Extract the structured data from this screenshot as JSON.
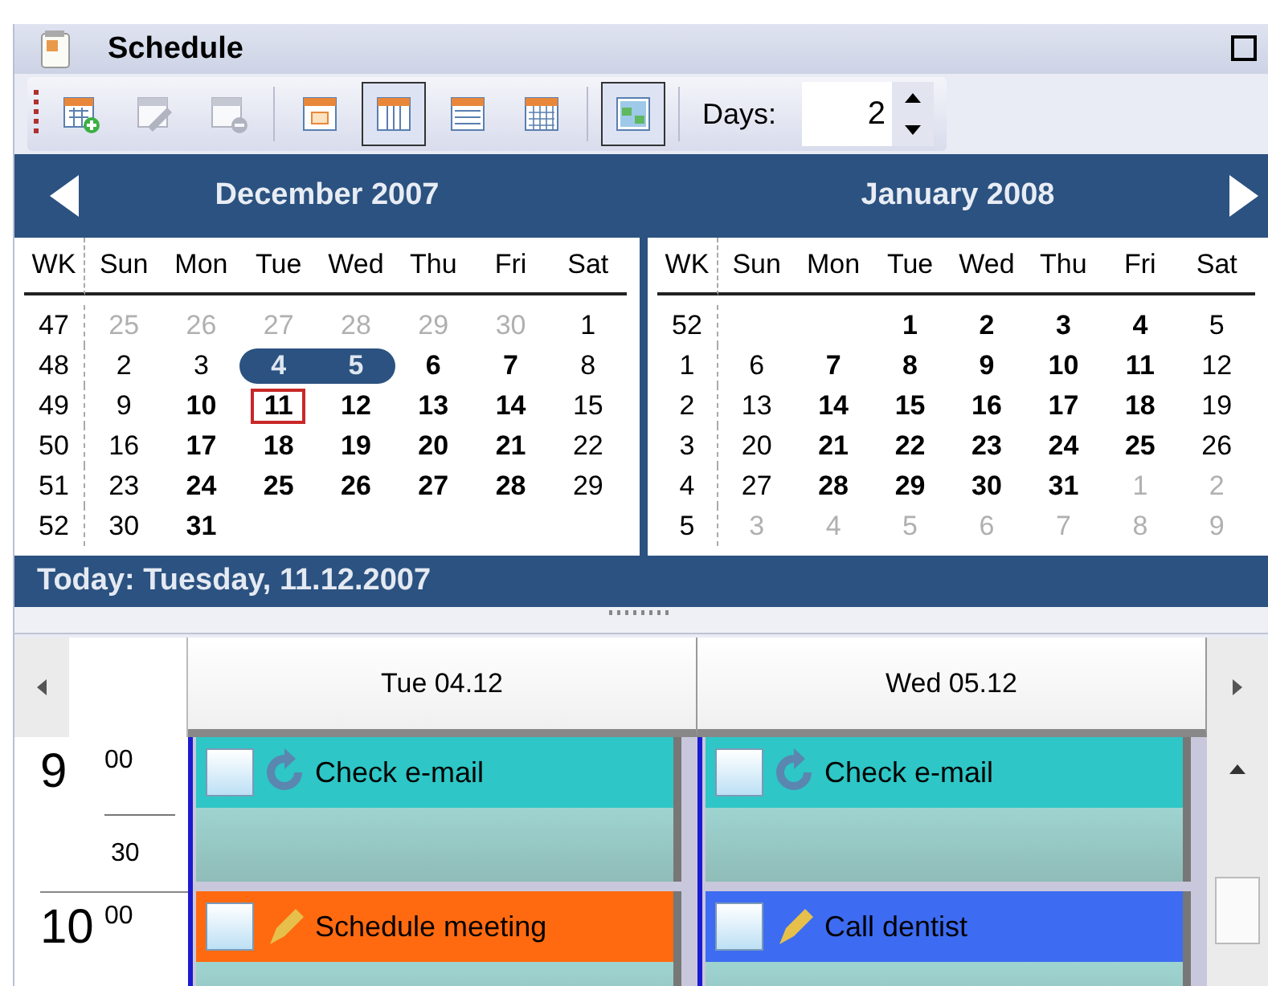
{
  "window": {
    "title": "Schedule"
  },
  "toolbar": {
    "buttons": [
      {
        "kind": "add",
        "disabled": false,
        "selected": false
      },
      {
        "kind": "edit",
        "disabled": true,
        "selected": false
      },
      {
        "kind": "delete",
        "disabled": true,
        "selected": false
      },
      {
        "kind": "day",
        "disabled": false,
        "selected": false
      },
      {
        "kind": "week",
        "disabled": false,
        "selected": true
      },
      {
        "kind": "list",
        "disabled": false,
        "selected": false
      },
      {
        "kind": "month",
        "disabled": false,
        "selected": false
      },
      {
        "kind": "grid",
        "disabled": false,
        "selected": true
      }
    ],
    "days_label": "Days:",
    "days_value": "2"
  },
  "months": [
    {
      "title": "December 2007",
      "weekdays": [
        "WK",
        "Sun",
        "Mon",
        "Tue",
        "Wed",
        "Thu",
        "Fri",
        "Sat"
      ],
      "weeks": [
        {
          "wk": "47",
          "days": [
            {
              "text": "25",
              "kind": "muted",
              "selected": false,
              "today": false
            },
            {
              "text": "26",
              "kind": "muted",
              "selected": false,
              "today": false
            },
            {
              "text": "27",
              "kind": "muted",
              "selected": false,
              "today": false
            },
            {
              "text": "28",
              "kind": "muted",
              "selected": false,
              "today": false
            },
            {
              "text": "29",
              "kind": "muted",
              "selected": false,
              "today": false
            },
            {
              "text": "30",
              "kind": "muted",
              "selected": false,
              "today": false
            },
            {
              "text": "1",
              "kind": "plain",
              "selected": false,
              "today": false
            }
          ]
        },
        {
          "wk": "48",
          "days": [
            {
              "text": "2",
              "kind": "plain",
              "selected": false,
              "today": false
            },
            {
              "text": "3",
              "kind": "plain",
              "selected": false,
              "today": false
            },
            {
              "text": "4",
              "kind": "bold",
              "selected": true,
              "today": false
            },
            {
              "text": "5",
              "kind": "bold",
              "selected": true,
              "today": false
            },
            {
              "text": "6",
              "kind": "bold",
              "selected": false,
              "today": false
            },
            {
              "text": "7",
              "kind": "bold",
              "selected": false,
              "today": false
            },
            {
              "text": "8",
              "kind": "plain",
              "selected": false,
              "today": false
            }
          ]
        },
        {
          "wk": "49",
          "days": [
            {
              "text": "9",
              "kind": "plain",
              "selected": false,
              "today": false
            },
            {
              "text": "10",
              "kind": "bold",
              "selected": false,
              "today": false
            },
            {
              "text": "11",
              "kind": "bold",
              "selected": false,
              "today": true
            },
            {
              "text": "12",
              "kind": "bold",
              "selected": false,
              "today": false
            },
            {
              "text": "13",
              "kind": "bold",
              "selected": false,
              "today": false
            },
            {
              "text": "14",
              "kind": "bold",
              "selected": false,
              "today": false
            },
            {
              "text": "15",
              "kind": "plain",
              "selected": false,
              "today": false
            }
          ]
        },
        {
          "wk": "50",
          "days": [
            {
              "text": "16",
              "kind": "plain",
              "selected": false,
              "today": false
            },
            {
              "text": "17",
              "kind": "bold",
              "selected": false,
              "today": false
            },
            {
              "text": "18",
              "kind": "bold",
              "selected": false,
              "today": false
            },
            {
              "text": "19",
              "kind": "bold",
              "selected": false,
              "today": false
            },
            {
              "text": "20",
              "kind": "bold",
              "selected": false,
              "today": false
            },
            {
              "text": "21",
              "kind": "bold",
              "selected": false,
              "today": false
            },
            {
              "text": "22",
              "kind": "plain",
              "selected": false,
              "today": false
            }
          ]
        },
        {
          "wk": "51",
          "days": [
            {
              "text": "23",
              "kind": "plain",
              "selected": false,
              "today": false
            },
            {
              "text": "24",
              "kind": "bold",
              "selected": false,
              "today": false
            },
            {
              "text": "25",
              "kind": "bold",
              "selected": false,
              "today": false
            },
            {
              "text": "26",
              "kind": "bold",
              "selected": false,
              "today": false
            },
            {
              "text": "27",
              "kind": "bold",
              "selected": false,
              "today": false
            },
            {
              "text": "28",
              "kind": "bold",
              "selected": false,
              "today": false
            },
            {
              "text": "29",
              "kind": "plain",
              "selected": false,
              "today": false
            }
          ]
        },
        {
          "wk": "52",
          "days": [
            {
              "text": "30",
              "kind": "plain",
              "selected": false,
              "today": false
            },
            {
              "text": "31",
              "kind": "bold",
              "selected": false,
              "today": false
            },
            {
              "kind": "blank"
            },
            {
              "kind": "blank"
            },
            {
              "kind": "blank"
            },
            {
              "kind": "blank"
            },
            {
              "kind": "blank"
            }
          ]
        }
      ]
    },
    {
      "title": "January 2008",
      "weekdays": [
        "WK",
        "Sun",
        "Mon",
        "Tue",
        "Wed",
        "Thu",
        "Fri",
        "Sat"
      ],
      "weeks": [
        {
          "wk": "52",
          "days": [
            {
              "kind": "blank"
            },
            {
              "kind": "blank"
            },
            {
              "text": "1",
              "kind": "bold",
              "selected": false,
              "today": false
            },
            {
              "text": "2",
              "kind": "bold",
              "selected": false,
              "today": false
            },
            {
              "text": "3",
              "kind": "bold",
              "selected": false,
              "today": false
            },
            {
              "text": "4",
              "kind": "bold",
              "selected": false,
              "today": false
            },
            {
              "text": "5",
              "kind": "plain",
              "selected": false,
              "today": false
            }
          ]
        },
        {
          "wk": "1",
          "days": [
            {
              "text": "6",
              "kind": "plain",
              "selected": false,
              "today": false
            },
            {
              "text": "7",
              "kind": "bold",
              "selected": false,
              "today": false
            },
            {
              "text": "8",
              "kind": "bold",
              "selected": false,
              "today": false
            },
            {
              "text": "9",
              "kind": "bold",
              "selected": false,
              "today": false
            },
            {
              "text": "10",
              "kind": "bold",
              "selected": false,
              "today": false
            },
            {
              "text": "11",
              "kind": "bold",
              "selected": false,
              "today": false
            },
            {
              "text": "12",
              "kind": "plain",
              "selected": false,
              "today": false
            }
          ]
        },
        {
          "wk": "2",
          "days": [
            {
              "text": "13",
              "kind": "plain",
              "selected": false,
              "today": false
            },
            {
              "text": "14",
              "kind": "bold",
              "selected": false,
              "today": false
            },
            {
              "text": "15",
              "kind": "bold",
              "selected": false,
              "today": false
            },
            {
              "text": "16",
              "kind": "bold",
              "selected": false,
              "today": false
            },
            {
              "text": "17",
              "kind": "bold",
              "selected": false,
              "today": false
            },
            {
              "text": "18",
              "kind": "bold",
              "selected": false,
              "today": false
            },
            {
              "text": "19",
              "kind": "plain",
              "selected": false,
              "today": false
            }
          ]
        },
        {
          "wk": "3",
          "days": [
            {
              "text": "20",
              "kind": "plain",
              "selected": false,
              "today": false
            },
            {
              "text": "21",
              "kind": "bold",
              "selected": false,
              "today": false
            },
            {
              "text": "22",
              "kind": "bold",
              "selected": false,
              "today": false
            },
            {
              "text": "23",
              "kind": "bold",
              "selected": false,
              "today": false
            },
            {
              "text": "24",
              "kind": "bold",
              "selected": false,
              "today": false
            },
            {
              "text": "25",
              "kind": "bold",
              "selected": false,
              "today": false
            },
            {
              "text": "26",
              "kind": "plain",
              "selected": false,
              "today": false
            }
          ]
        },
        {
          "wk": "4",
          "days": [
            {
              "text": "27",
              "kind": "plain",
              "selected": false,
              "today": false
            },
            {
              "text": "28",
              "kind": "bold",
              "selected": false,
              "today": false
            },
            {
              "text": "29",
              "kind": "bold",
              "selected": false,
              "today": false
            },
            {
              "text": "30",
              "kind": "bold",
              "selected": false,
              "today": false
            },
            {
              "text": "31",
              "kind": "bold",
              "selected": false,
              "today": false
            },
            {
              "text": "1",
              "kind": "muted",
              "selected": false,
              "today": false
            },
            {
              "text": "2",
              "kind": "muted",
              "selected": false,
              "today": false
            }
          ]
        },
        {
          "wk": "5",
          "days": [
            {
              "text": "3",
              "kind": "muted",
              "selected": false,
              "today": false
            },
            {
              "text": "4",
              "kind": "muted",
              "selected": false,
              "today": false
            },
            {
              "text": "5",
              "kind": "muted",
              "selected": false,
              "today": false
            },
            {
              "text": "6",
              "kind": "muted",
              "selected": false,
              "today": false
            },
            {
              "text": "7",
              "kind": "muted",
              "selected": false,
              "today": false
            },
            {
              "text": "8",
              "kind": "muted",
              "selected": false,
              "today": false
            },
            {
              "text": "9",
              "kind": "muted",
              "selected": false,
              "today": false
            }
          ]
        }
      ]
    }
  ],
  "today_bar": "Today: Tuesday, 11.12.2007",
  "day_view": {
    "columns": [
      {
        "header": "Tue 04.12",
        "appointments": [
          {
            "title": "Check e-mail",
            "kind": "recurring",
            "color": "#2ec6c6",
            "checked": false
          },
          {
            "title": "Schedule meeting",
            "kind": "task",
            "color": "#ff6a10",
            "checked": false
          }
        ]
      },
      {
        "header": "Wed 05.12",
        "appointments": [
          {
            "title": "Check e-mail",
            "kind": "recurring",
            "color": "#2ec6c6",
            "checked": false
          },
          {
            "title": "Call dentist",
            "kind": "task",
            "color": "#3d6cf2",
            "checked": false
          }
        ]
      }
    ],
    "hours": [
      {
        "hour": "9",
        "minutes": "00",
        "half": "30"
      },
      {
        "hour": "10",
        "minutes": "00"
      }
    ]
  }
}
